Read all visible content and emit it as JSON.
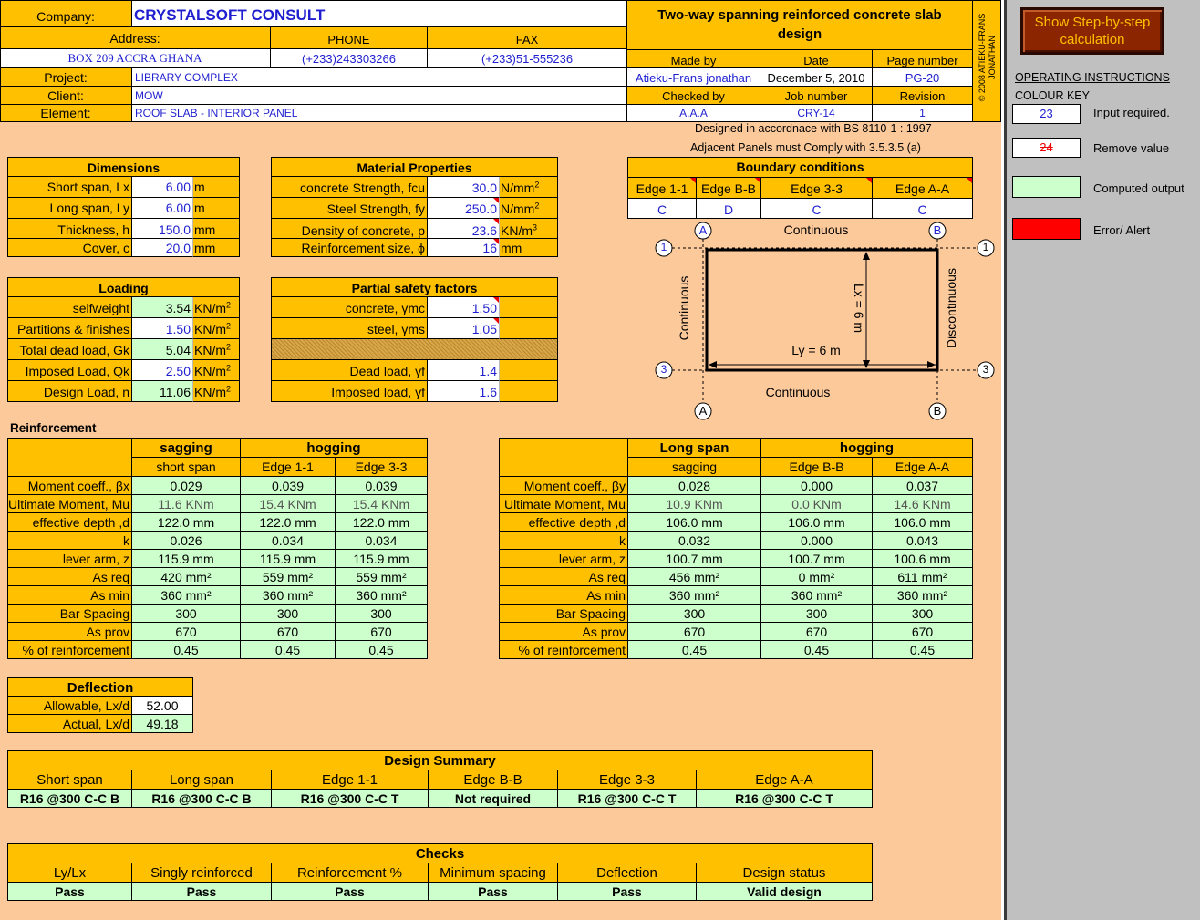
{
  "header": {
    "company_label": "Company:",
    "company_name": "CRYSTALSOFT CONSULT",
    "address_label": "Address:",
    "address": "BOX 209 ACCRA GHANA",
    "phone_label": "PHONE",
    "phone": "(+233)243303266",
    "fax_label": "FAX",
    "fax": "(+233)51-555236",
    "project_label": "Project:",
    "project": "LIBRARY COMPLEX",
    "client_label": "Client:",
    "client": "MOW",
    "element_label": "Element:",
    "element": "ROOF SLAB - INTERIOR PANEL",
    "title": "Two-way spanning reinforced concrete slab design",
    "made_by_label": "Made by",
    "made_by": "Atieku-Frans jonathan",
    "date_label": "Date",
    "date": "December 5, 2010",
    "page_label": "Page number",
    "page": "PG-20",
    "checked_label": "Checked by",
    "checked": "A.A.A",
    "job_label": "Job number",
    "job": "CRY-14",
    "revision_label": "Revision",
    "revision": "1",
    "copyright": "© 2008 ATIEKU-FRANS JONATHAN",
    "design_code": "Designed in accordnace with BS 8110-1 : 1997",
    "adjacent_note": "Adjacent Panels must Comply with 3.5.3.5 (a)"
  },
  "dimensions": {
    "title": "Dimensions",
    "rows": [
      {
        "label": "Short span, Lx",
        "value": "6.00",
        "unit": "m"
      },
      {
        "label": "Long span, Ly",
        "value": "6.00",
        "unit": "m"
      },
      {
        "label": "Thickness, h",
        "value": "150.0",
        "unit": "mm"
      },
      {
        "label": "Cover, c",
        "value": "20.0",
        "unit": "mm"
      }
    ]
  },
  "materials": {
    "title": "Material Properties",
    "rows": [
      {
        "label": "concrete Strength, fcu",
        "value": "30.0",
        "unit": "N/mm",
        "sup": "2"
      },
      {
        "label": "Steel Strength, fy",
        "value": "250.0",
        "unit": "N/mm",
        "sup": "2"
      },
      {
        "label": "Density of concrete, p",
        "value": "23.6",
        "unit": "KN/m",
        "sup": "3"
      },
      {
        "label": "Reinforcement size, ϕ",
        "value": "16",
        "unit": "mm",
        "sup": ""
      }
    ]
  },
  "loading": {
    "title": "Loading",
    "rows": [
      {
        "label": "selfweight",
        "value": "3.54",
        "unit": "KN/m",
        "sup": "2"
      },
      {
        "label": "Partitions & finishes",
        "value": "1.50",
        "unit": "KN/m",
        "sup": "2"
      },
      {
        "label": "Total dead load, Gk",
        "value": "5.04",
        "unit": "KN/m",
        "sup": "2"
      },
      {
        "label": "Imposed Load, Qk",
        "value": "2.50",
        "unit": "KN/m",
        "sup": "2"
      },
      {
        "label": "Design Load, n",
        "value": "11.06",
        "unit": "KN/m",
        "sup": "2"
      }
    ]
  },
  "safety": {
    "title": "Partial safety factors",
    "rows": [
      {
        "label": "concrete, γmc",
        "value": "1.50"
      },
      {
        "label": "steel, γms",
        "value": "1.05"
      },
      {
        "label": "",
        "value": ""
      },
      {
        "label": "Dead load, γf",
        "value": "1.4"
      },
      {
        "label": "Imposed load, γf",
        "value": "1.6"
      }
    ]
  },
  "boundary": {
    "title": "Boundary conditions",
    "edges": [
      "Edge 1-1",
      "Edge B-B",
      "Edge 3-3",
      "Edge A-A"
    ],
    "values": [
      "C",
      "D",
      "C",
      "C"
    ],
    "diagram": {
      "top": "Continuous",
      "bottom": "Continuous",
      "left": "Continuous",
      "right": "Discontinuous",
      "lx": "Lx = 6 m",
      "ly": "Ly = 6 m",
      "grid_a": "A",
      "grid_b": "B",
      "grid_1": "1",
      "grid_3": "3"
    }
  },
  "reinforcement": {
    "title": "Reinforcement",
    "short": {
      "group1": "sagging",
      "group2": "hogging",
      "cols": [
        "short span",
        "Edge 1-1",
        "Edge 3-3"
      ],
      "rows": [
        {
          "label": "Moment coeff., βx",
          "v": [
            "0.029",
            "0.039",
            "0.039"
          ]
        },
        {
          "label": "Ultimate Moment, Mu",
          "v": [
            "11.6 KNm",
            "15.4 KNm",
            "15.4 KNm"
          ]
        },
        {
          "label": "effective depth ,d",
          "v": [
            "122.0 mm",
            "122.0 mm",
            "122.0 mm"
          ]
        },
        {
          "label": "k",
          "v": [
            "0.026",
            "0.034",
            "0.034"
          ]
        },
        {
          "label": "lever arm, z",
          "v": [
            "115.9 mm",
            "115.9 mm",
            "115.9 mm"
          ]
        },
        {
          "label": "As req",
          "v": [
            "420 mm²",
            "559 mm²",
            "559 mm²"
          ]
        },
        {
          "label": "As min",
          "v": [
            "360 mm²",
            "360 mm²",
            "360 mm²"
          ]
        },
        {
          "label": "Bar Spacing",
          "v": [
            "300",
            "300",
            "300"
          ]
        },
        {
          "label": "As prov",
          "v": [
            "670",
            "670",
            "670"
          ]
        },
        {
          "label": "% of reinforcement",
          "v": [
            "0.45",
            "0.45",
            "0.45"
          ]
        }
      ]
    },
    "long": {
      "group1": "Long span",
      "group2": "hogging",
      "cols": [
        "sagging",
        "Edge B-B",
        "Edge A-A"
      ],
      "rows": [
        {
          "label": "Moment coeff., βy",
          "v": [
            "0.028",
            "0.000",
            "0.037"
          ]
        },
        {
          "label": "Ultimate Moment, Mu",
          "v": [
            "10.9 KNm",
            "0.0 KNm",
            "14.6 KNm"
          ]
        },
        {
          "label": "effective depth ,d",
          "v": [
            "106.0 mm",
            "106.0 mm",
            "106.0 mm"
          ]
        },
        {
          "label": "k",
          "v": [
            "0.032",
            "0.000",
            "0.043"
          ]
        },
        {
          "label": "lever arm, z",
          "v": [
            "100.7 mm",
            "100.7 mm",
            "100.6 mm"
          ]
        },
        {
          "label": "As req",
          "v": [
            "456 mm²",
            "0 mm²",
            "611 mm²"
          ]
        },
        {
          "label": "As min",
          "v": [
            "360 mm²",
            "360 mm²",
            "360 mm²"
          ]
        },
        {
          "label": "Bar Spacing",
          "v": [
            "300",
            "300",
            "300"
          ]
        },
        {
          "label": "As prov",
          "v": [
            "670",
            "670",
            "670"
          ]
        },
        {
          "label": "% of reinforcement",
          "v": [
            "0.45",
            "0.45",
            "0.45"
          ]
        }
      ]
    }
  },
  "deflection": {
    "title": "Deflection",
    "rows": [
      {
        "label": "Allowable, Lx/d",
        "value": "52.00"
      },
      {
        "label": "Actual, Lx/d",
        "value": "49.18"
      }
    ]
  },
  "summary": {
    "title": "Design Summary",
    "cols": [
      "Short span",
      "Long span",
      "Edge 1-1",
      "Edge B-B",
      "Edge 3-3",
      "Edge A-A"
    ],
    "values": [
      "R16 @300 C-C B",
      "R16 @300 C-C B",
      "R16 @300 C-C T",
      "Not required",
      "R16 @300 C-C T",
      "R16 @300 C-C T"
    ]
  },
  "checks": {
    "title": "Checks",
    "cols": [
      "Ly/Lx",
      "Singly reinforced",
      "Reinforcement %",
      "Minimum spacing",
      "Deflection",
      "Design status"
    ],
    "values": [
      "Pass",
      "Pass",
      "Pass",
      "Pass",
      "Pass",
      "Valid design"
    ]
  },
  "sidebar": {
    "button": "Show Step-by-step calculation",
    "instructions": "OPERATING INSTRUCTIONS",
    "colour_key": "COLOUR KEY",
    "keys": [
      {
        "sample": "23",
        "label": "Input required."
      },
      {
        "sample": "24",
        "label": "Remove value"
      },
      {
        "sample": "",
        "label": "Computed output"
      },
      {
        "sample": "",
        "label": "Error/ Alert"
      }
    ],
    "colors": {
      "input": "#ffffff",
      "computed": "#ccffcc",
      "error": "#ff0000",
      "button": "#8b2500"
    }
  }
}
